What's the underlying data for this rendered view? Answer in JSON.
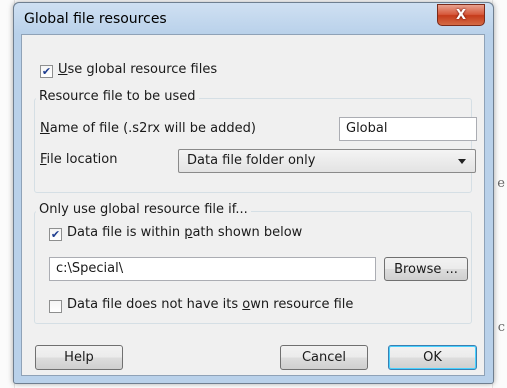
{
  "window": {
    "title": "Global file resources",
    "close_glyph": "X"
  },
  "use_global": {
    "checked": true,
    "mnemonic": "U",
    "label_rest": "se global resource files"
  },
  "resource_group": {
    "title": "Resource file to be used",
    "name_label_mnemonic": "N",
    "name_label_rest": "ame of file (.s2rx will be added)",
    "name_value": "Global",
    "location_label_mnemonic": "F",
    "location_label_rest": "ile location",
    "location_selected": "Data file folder only"
  },
  "condition_group": {
    "title": "Only use global resource file if...",
    "within_path": {
      "checked": true,
      "label_before": "Data file is within ",
      "mnemonic": "p",
      "label_after": "ath shown below"
    },
    "path_value": "c:\\Special\\",
    "browse_label": "Browse ...",
    "no_own": {
      "checked": false,
      "label_before": "Data file does not have its ",
      "mnemonic": "o",
      "label_after": "wn resource file"
    }
  },
  "buttons": {
    "help": "Help",
    "cancel": "Cancel",
    "ok": "OK"
  },
  "background": {
    "right_chars": [
      "e",
      "c"
    ]
  },
  "colors": {
    "close_button": "#c8442a",
    "frame": "#b9d1ea",
    "client": "#f0f0f0",
    "default_button_border": "#3c7fb1"
  }
}
